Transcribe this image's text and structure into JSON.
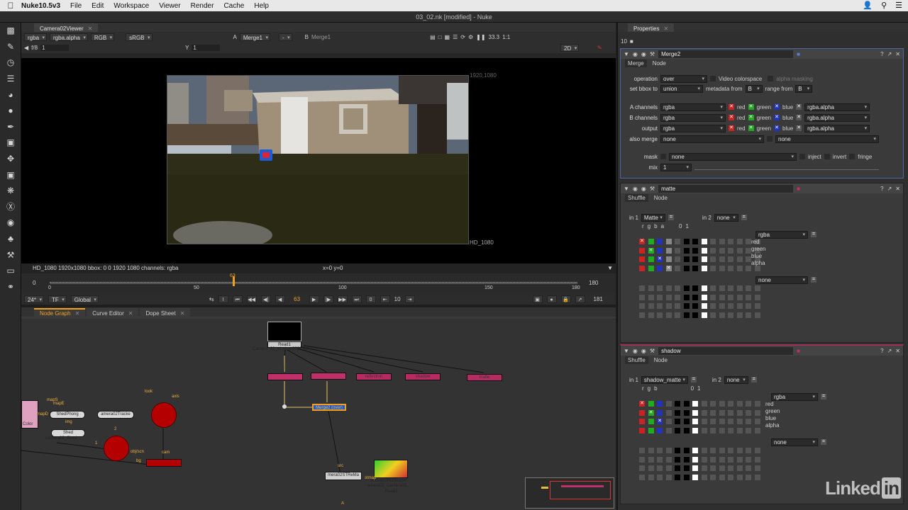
{
  "menubar": {
    "app": "Nuke10.5v3",
    "items": [
      "File",
      "Edit",
      "Workspace",
      "Viewer",
      "Render",
      "Cache",
      "Help"
    ]
  },
  "window_title": "03_02.nk [modified] - Nuke",
  "viewer": {
    "tab": "Camera02Viewer",
    "channels": "rgba",
    "alpha": "rgba.alpha",
    "colorspace_a": "RGB",
    "lut": "sRGB",
    "input_a_label": "A",
    "input_a": "Merge1",
    "input_b_label": "B",
    "input_b": "Merge1",
    "dash": "-",
    "zoom": "33.3",
    "ratio": "1:1",
    "mode": "2D",
    "fstop": "f/8",
    "gain": "1",
    "y_label": "Y",
    "gamma": "1",
    "format_tr": "1920,1080",
    "format_br": "HD_1080",
    "info": "HD_1080 1920x1080  bbox: 0 0 1920 1080 channels: rgba",
    "coords": "x=0 y=0",
    "timeline": {
      "start": "0",
      "end": "180",
      "current": "63",
      "ticks": [
        "0",
        "50",
        "100",
        "150",
        "180"
      ]
    },
    "playbar": {
      "fps": "24*",
      "tf": "TF",
      "scope": "Global",
      "frame": "63",
      "step": "10",
      "zero": "0",
      "last": "181"
    }
  },
  "nodegraph": {
    "tabs": [
      "Node Graph",
      "Curve Editor",
      "Dope Sheet"
    ],
    "nodes": {
      "read": "Read1",
      "read_file": "Camera_02_window.0001.exr",
      "merge": "Merge2 (over)",
      "reflection": "reflection",
      "shadow": "shadow",
      "matte": "matte",
      "phong": "ShedPhong",
      "tracker": "amera02Tracke",
      "shed": "Shed",
      "shed_file": "camera02_Shed...",
      "st": "mera02STReMa",
      "reader": "amera02RDReader",
      "reader_file": "amera02_Camera02...",
      "read2": "Read1"
    },
    "labels": [
      "mapS",
      "mapE",
      "mapD",
      "img",
      "Color",
      "look",
      "axis",
      "2",
      "1",
      "obj/scn",
      "cam",
      "bg",
      "src",
      "stmap",
      "A"
    ]
  },
  "properties": {
    "tab": "Properties",
    "max_panels": "10",
    "merge": {
      "name": "Merge2",
      "tabs": [
        "Merge",
        "Node"
      ],
      "operation_label": "operation",
      "operation": "over",
      "video_colorspace": "Video colorspace",
      "alpha_masking": "alpha masking",
      "bbox_label": "set bbox to",
      "bbox": "union",
      "metadata_label": "metadata from",
      "metadata": "B",
      "range_label": "range from",
      "range": "B",
      "a_label": "A channels",
      "a_val": "rgba",
      "b_label": "B channels",
      "b_val": "rgba",
      "out_label": "output",
      "out_val": "rgba",
      "also_label": "also merge",
      "also_val": "none",
      "also_val2": "none",
      "chan_red": "red",
      "chan_green": "green",
      "chan_blue": "blue",
      "chan_alpha": "rgba.alpha",
      "mask_label": "mask",
      "mask_val": "none",
      "inject": "inject",
      "invert": "invert",
      "fringe": "fringe",
      "mix_label": "mix",
      "mix_val": "1"
    },
    "matte": {
      "name": "matte",
      "tabs": [
        "Shuffle",
        "Node"
      ],
      "in1_label": "in 1",
      "in1": "Matte",
      "in2_label": "in 2",
      "in2": "none",
      "out1": "rgba",
      "out2": "none",
      "cols": [
        "r",
        "g",
        "b",
        "a"
      ],
      "zero_one": [
        "0",
        "1"
      ],
      "outs": [
        "red",
        "green",
        "blue",
        "alpha"
      ]
    },
    "shadow": {
      "name": "shadow",
      "tabs": [
        "Shuffle",
        "Node"
      ],
      "in1_label": "in 1",
      "in1": "shadow_matte",
      "in2_label": "in 2",
      "in2": "none",
      "out1": "rgba",
      "out2": "none",
      "cols": [
        "r",
        "g",
        "b"
      ],
      "zero_one": [
        "0",
        "1"
      ],
      "outs": [
        "red",
        "green",
        "blue",
        "alpha"
      ]
    }
  },
  "watermark": {
    "text": "Linked",
    "in": "in"
  }
}
